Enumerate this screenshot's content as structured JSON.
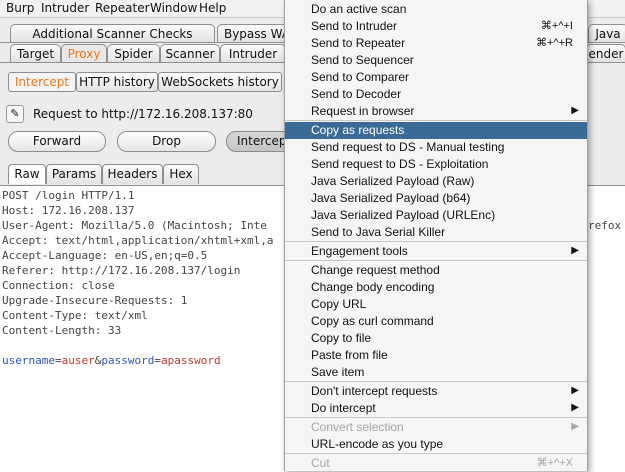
{
  "menubar": [
    "Burp",
    "Intruder",
    "Repeater",
    "Window",
    "Help"
  ],
  "top_tabs_row1": [
    "Additional Scanner Checks",
    "Bypass WA",
    "Java"
  ],
  "top_tabs_row2": [
    "Target",
    "Proxy",
    "Spider",
    "Scanner",
    "Intruder",
    "ender"
  ],
  "proxy_tabs": [
    "Intercept",
    "HTTP history",
    "WebSockets history"
  ],
  "request_label": "Request to http://172.16.208.137:80",
  "buttons": {
    "forward": "Forward",
    "drop": "Drop",
    "intercept": "Intercep"
  },
  "view_tabs": [
    "Raw",
    "Params",
    "Headers",
    "Hex"
  ],
  "request_lines": [
    "POST /login HTTP/1.1",
    "Host: 172.16.208.137",
    "User-Agent: Mozilla/5.0 (Macintosh; Inte",
    "Accept: text/html,application/xhtml+xml,a",
    "Accept-Language: en-US,en;q=0.5",
    "Referer: http://172.16.208.137/login",
    "Connection: close",
    "Upgrade-Insecure-Requests: 1",
    "Content-Type: text/xml",
    "Content-Length: 33"
  ],
  "user_agent_tail": "refox",
  "body_params": {
    "n1": "username",
    "v1": "auser",
    "amp": "&",
    "n2": "password",
    "v2": "apassword",
    "eq": "="
  },
  "context_menu": {
    "items": [
      "Do an active scan",
      "Send to Intruder",
      "Send to Repeater",
      "Send to Sequencer",
      "Send to Comparer",
      "Send to Decoder",
      "Request in browser",
      "Copy as requests",
      "Send request to DS - Manual testing",
      "Send request to DS - Exploitation",
      "Java Serialized Payload (Raw)",
      "Java Serialized Payload (b64)",
      "Java Serialized Payload (URLEnc)",
      "Send to Java Serial Killer",
      "Engagement tools",
      "Change request method",
      "Change body encoding",
      "Copy URL",
      "Copy as curl command",
      "Copy to file",
      "Paste from file",
      "Save item",
      "Don't intercept requests",
      "Do intercept",
      "Convert selection",
      "URL-encode as you type",
      "Cut"
    ],
    "shortcuts": {
      "intruder": "⌘+^+I",
      "repeater": "⌘+^+R",
      "cut": "⌘+^+X"
    },
    "submenu_arrow": "▶",
    "highlight_color": "#3a6a95"
  }
}
